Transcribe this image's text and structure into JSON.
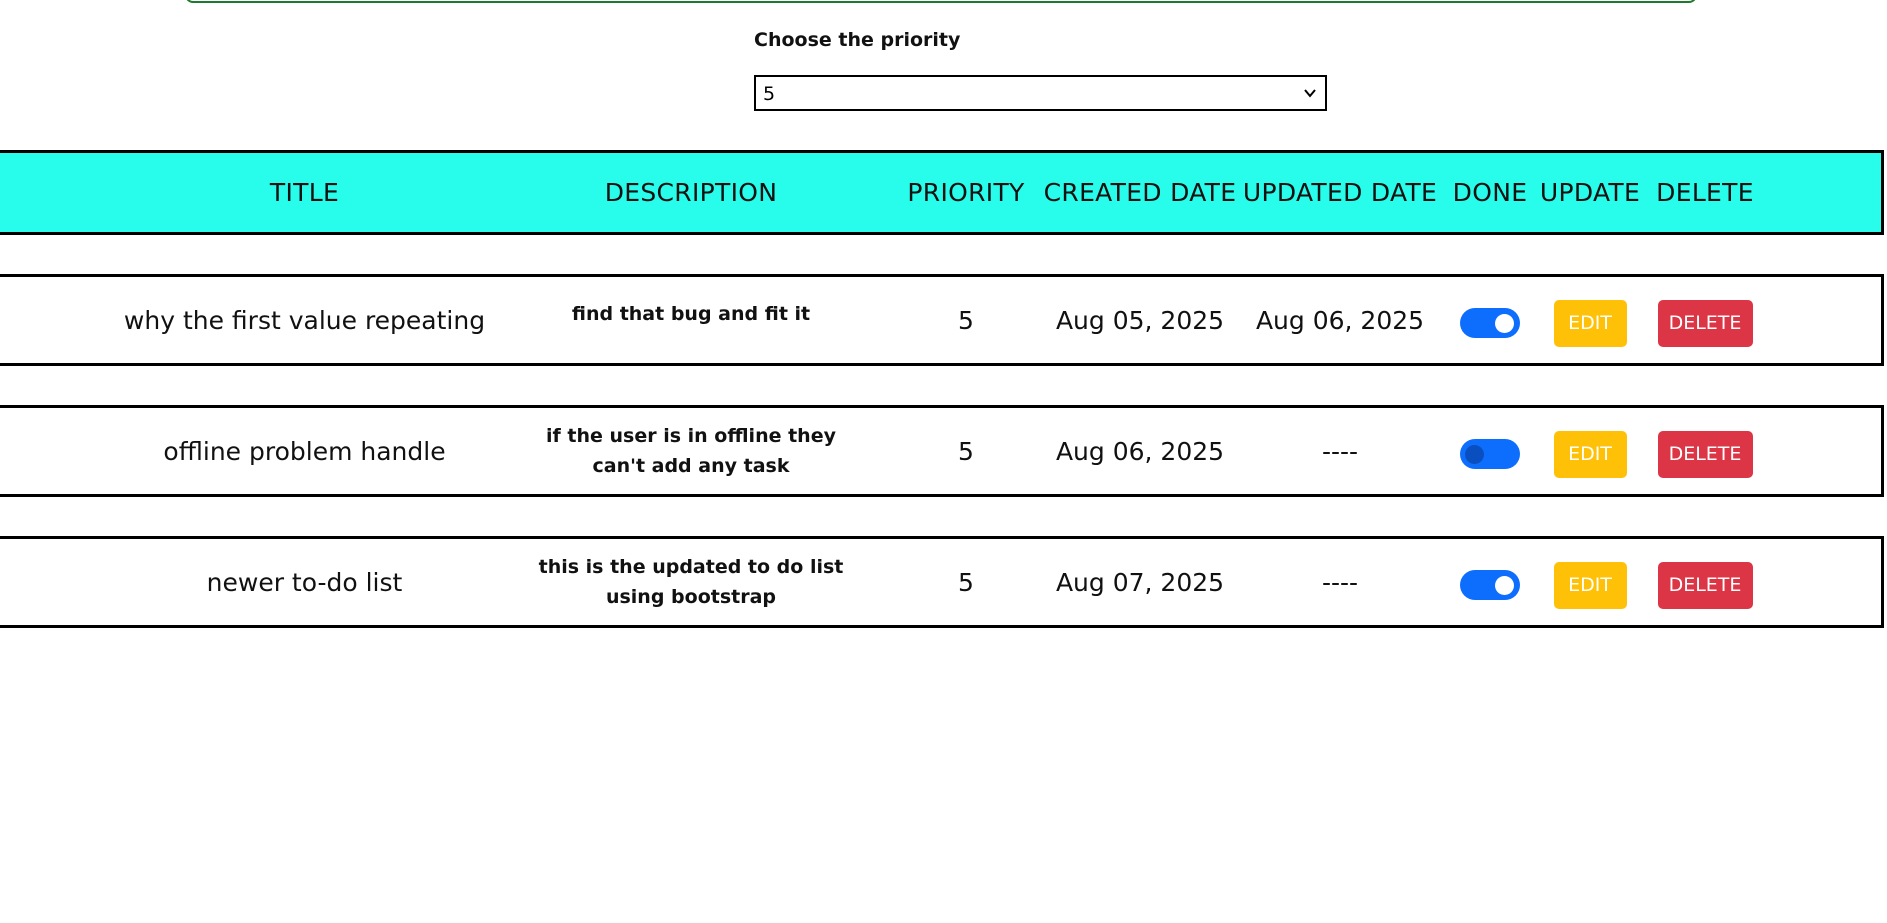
{
  "filter": {
    "label": "Choose the priority",
    "selected": "5"
  },
  "table": {
    "headers": [
      "TITLE",
      "DESCRIPTION",
      "PRIORITY",
      "CREATED DATE",
      "UPDATED DATE",
      "DONE",
      "UPDATE",
      "DELETE"
    ],
    "rows": [
      {
        "title": "why the first value repeating",
        "description": "find that bug and fit it",
        "priority": "5",
        "created": "Aug 05, 2025",
        "updated": "Aug 06, 2025",
        "done": true,
        "edit_label": "EDIT",
        "delete_label": "DELETE"
      },
      {
        "title": "offline problem handle",
        "description": "if the user is in offline they can't add any task",
        "priority": "5",
        "created": "Aug 06, 2025",
        "updated": "----",
        "done": false,
        "edit_label": "EDIT",
        "delete_label": "DELETE"
      },
      {
        "title": "newer to-do list",
        "description": "this is the updated to do list using bootstrap",
        "priority": "5",
        "created": "Aug 07, 2025",
        "updated": "----",
        "done": true,
        "edit_label": "EDIT",
        "delete_label": "DELETE"
      }
    ]
  },
  "colors": {
    "header_bg": "#28fcea",
    "toggle": "#0d6efd",
    "edit": "#ffc107",
    "delete": "#dc3545",
    "top_border": "#1f7a2b"
  }
}
